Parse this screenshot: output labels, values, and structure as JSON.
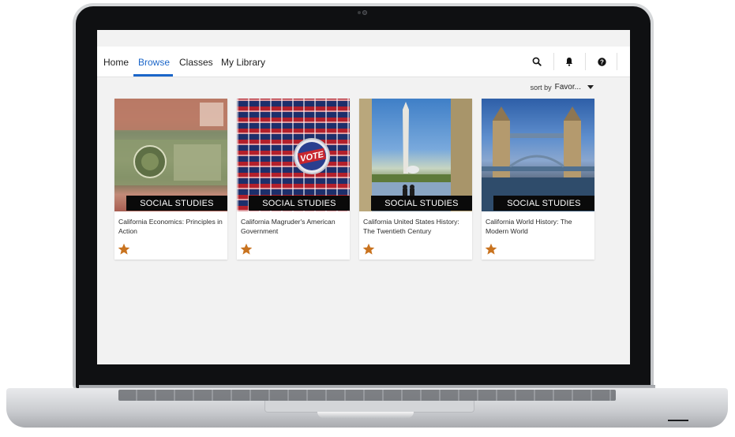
{
  "nav": {
    "tabs": [
      {
        "label": "Home"
      },
      {
        "label": "Browse"
      },
      {
        "label": "Classes"
      },
      {
        "label": "My Library"
      }
    ],
    "icons": [
      "search-icon",
      "bell-icon",
      "help-icon"
    ]
  },
  "sort": {
    "label": "sort by",
    "value": "Favor..."
  },
  "cards": [
    {
      "category": "SOCIAL STUDIES",
      "title": "California Economics: Principles in Action",
      "cover": "money-icon"
    },
    {
      "category": "SOCIAL STUDIES",
      "title": "California Magruder's American Government",
      "cover": "vote-button-icon"
    },
    {
      "category": "SOCIAL STUDIES",
      "title": "California United States History: The Twentieth Century",
      "cover": "monument-icon"
    },
    {
      "category": "SOCIAL STUDIES",
      "title": "California World History: The Modern World",
      "cover": "tower-bridge-icon"
    }
  ],
  "colors": {
    "accent": "#1b66c9",
    "star": "#c9731f",
    "label_bg": "#0a0a0a"
  }
}
